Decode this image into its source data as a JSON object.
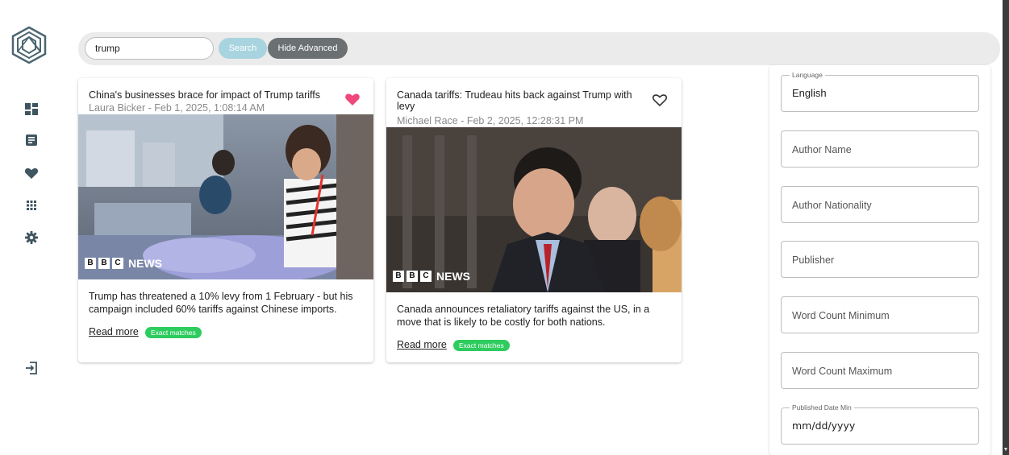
{
  "sidebar": {
    "items": [
      {
        "icon": "dashboard-icon"
      },
      {
        "icon": "article-icon"
      },
      {
        "icon": "heart-icon"
      },
      {
        "icon": "apps-grid-icon"
      },
      {
        "icon": "gear-icon"
      }
    ],
    "logout_icon": "logout-icon"
  },
  "search": {
    "value": "trump",
    "search_label": "Search",
    "hide_advanced_label": "Hide Advanced"
  },
  "articles": [
    {
      "title": "China's businesses brace for impact of Trump tariffs",
      "meta": "Laura Bicker - Feb 1, 2025, 1:08:14 AM",
      "description": "Trump has threatened a 10% levy from 1 February - but his campaign included 60% tariffs against Chinese imports.",
      "read_more": "Read more",
      "badge": "Exact matches",
      "favorited": true,
      "image_watermark": "NEWS"
    },
    {
      "title": "Canada tariffs: Trudeau hits back against Trump with levy",
      "meta": "Michael Race - Feb 2, 2025, 12:28:31 PM",
      "description": "Canada announces retaliatory tariffs against the US, in a move that is likely to be costly for both nations.",
      "read_more": "Read more",
      "badge": "Exact matches",
      "favorited": false,
      "image_watermark": "NEWS"
    }
  ],
  "advanced": {
    "language_label": "Language",
    "language_value": "English",
    "author_name_placeholder": "Author Name",
    "author_nationality_placeholder": "Author Nationality",
    "publisher_placeholder": "Publisher",
    "word_count_min_placeholder": "Word Count Minimum",
    "word_count_max_placeholder": "Word Count Maximum",
    "published_date_min_label": "Published Date Min",
    "published_date_min_value": "mm/dd/yyyy"
  },
  "colors": {
    "heart_filled": "#f0487a",
    "badge": "#2ecc5e",
    "search_button": "#a8d4df",
    "hide_advanced_button": "#6b7072",
    "sidebar_icon": "#3f5560"
  }
}
